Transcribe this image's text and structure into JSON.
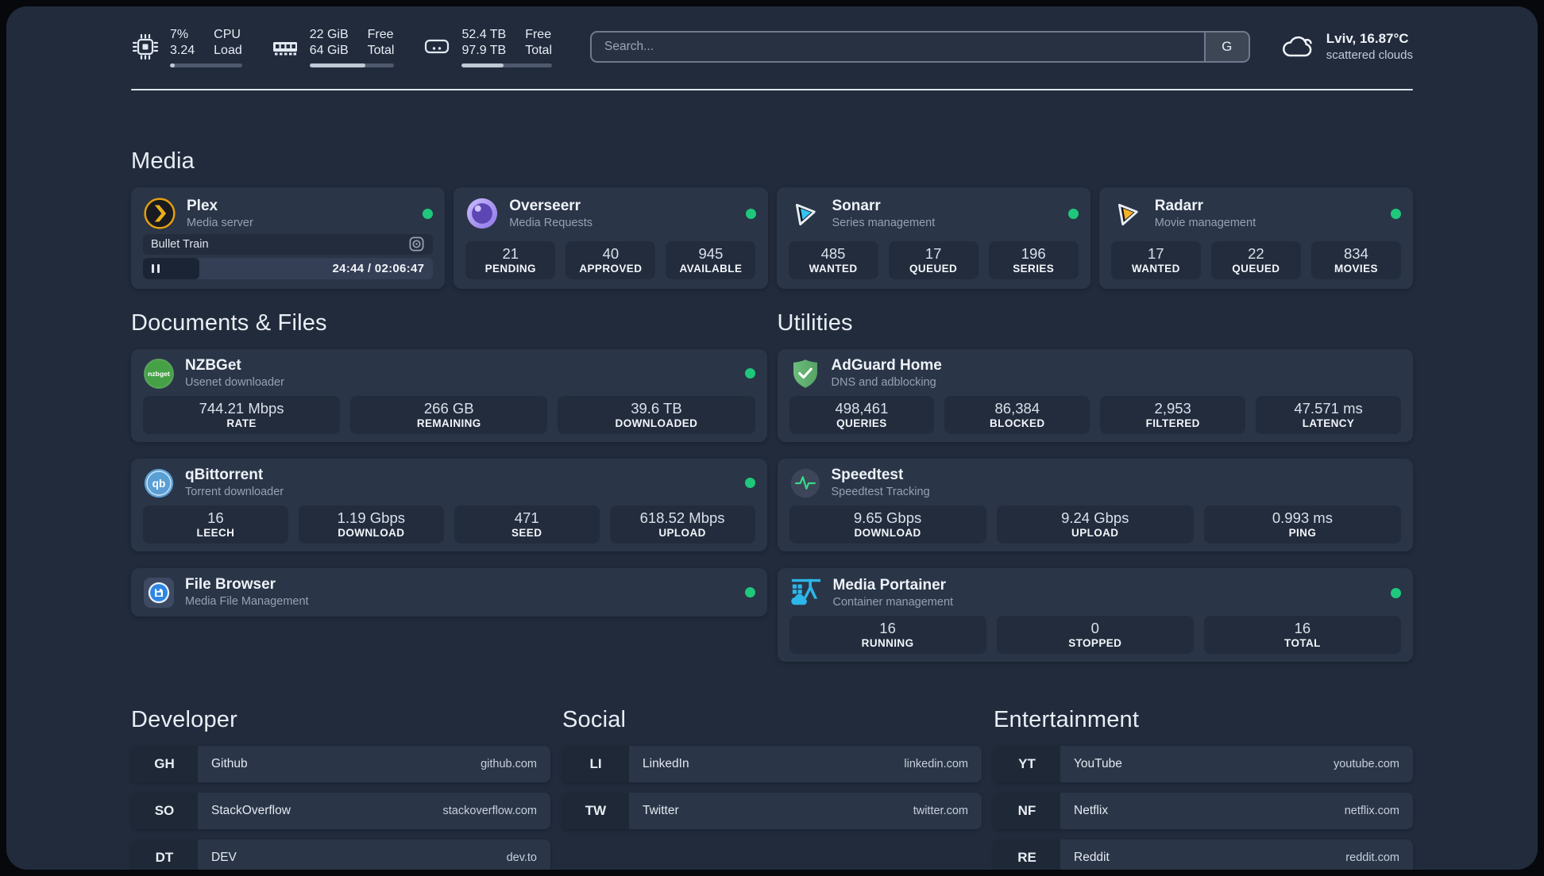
{
  "colors": {
    "page_bg": "#212b3c",
    "card_bg": "#2a3547",
    "inner_box_bg": "#222c3d",
    "status_online_green": "#1fc77c",
    "plex_amber": "#e5a00d",
    "sonarr_cyan": "#33c5f1",
    "radarr_amber": "#f6b126",
    "adguard_green": "#5fae6e",
    "speedtest_green": "#39d98a",
    "portainer_blue": "#2db6e8"
  },
  "topbar": {
    "cpu": {
      "icon": "cpu-icon",
      "line1_value": "7%",
      "line2_value": "3.24",
      "line1_label": "CPU",
      "line2_label": "Load",
      "progress_pct": 7
    },
    "memory": {
      "icon": "ram-icon",
      "line1_value": "22 GiB",
      "line2_value": "64 GiB",
      "line1_label": "Free",
      "line2_label": "Total",
      "progress_pct": 66
    },
    "disk": {
      "icon": "disk-icon",
      "line1_value": "52.4 TB",
      "line2_value": "97.9 TB",
      "line1_label": "Free",
      "line2_label": "Total",
      "progress_pct": 46
    },
    "search": {
      "placeholder": "Search...",
      "provider_label": "G"
    },
    "weather": {
      "icon": "cloud-icon",
      "location": "Lviv, 16.87°C",
      "condition": "scattered clouds"
    }
  },
  "sections": {
    "media": {
      "heading": "Media",
      "plex": {
        "icon": "plex-icon",
        "title": "Plex",
        "subtitle": "Media server",
        "online": true,
        "now_playing": "Bullet Train",
        "time_display": "24:44 / 02:06:47",
        "progress_pct": 19.5
      },
      "apps": [
        {
          "icon": "overseerr-icon",
          "title": "Overseerr",
          "subtitle": "Media Requests",
          "online": true,
          "stats": [
            {
              "value": "21",
              "label": "PENDING"
            },
            {
              "value": "40",
              "label": "APPROVED"
            },
            {
              "value": "945",
              "label": "AVAILABLE"
            }
          ]
        },
        {
          "icon": "sonarr-icon",
          "title": "Sonarr",
          "subtitle": "Series management",
          "online": true,
          "stats": [
            {
              "value": "485",
              "label": "WANTED"
            },
            {
              "value": "17",
              "label": "QUEUED"
            },
            {
              "value": "196",
              "label": "SERIES"
            }
          ]
        },
        {
          "icon": "radarr-icon",
          "title": "Radarr",
          "subtitle": "Movie management",
          "online": true,
          "stats": [
            {
              "value": "17",
              "label": "WANTED"
            },
            {
              "value": "22",
              "label": "QUEUED"
            },
            {
              "value": "834",
              "label": "MOVIES"
            }
          ]
        }
      ]
    },
    "documents": {
      "heading": "Documents & Files",
      "apps": [
        {
          "icon": "nzbget-icon",
          "title": "NZBGet",
          "subtitle": "Usenet downloader",
          "online": true,
          "stats": [
            {
              "value": "744.21 Mbps",
              "label": "RATE"
            },
            {
              "value": "266 GB",
              "label": "REMAINING"
            },
            {
              "value": "39.6 TB",
              "label": "DOWNLOADED"
            }
          ]
        },
        {
          "icon": "qbittorrent-icon",
          "title": "qBittorrent",
          "subtitle": "Torrent downloader",
          "online": true,
          "stats": [
            {
              "value": "16",
              "label": "LEECH"
            },
            {
              "value": "1.19 Gbps",
              "label": "DOWNLOAD"
            },
            {
              "value": "471",
              "label": "SEED"
            },
            {
              "value": "618.52 Mbps",
              "label": "UPLOAD"
            }
          ]
        },
        {
          "icon": "filebrowser-icon",
          "title": "File Browser",
          "subtitle": "Media File Management",
          "online": true,
          "stats": []
        }
      ]
    },
    "utilities": {
      "heading": "Utilities",
      "apps": [
        {
          "icon": "adguard-icon",
          "title": "AdGuard Home",
          "subtitle": "DNS and adblocking",
          "online": false,
          "stats": [
            {
              "value": "498,461",
              "label": "QUERIES"
            },
            {
              "value": "86,384",
              "label": "BLOCKED"
            },
            {
              "value": "2,953",
              "label": "FILTERED"
            },
            {
              "value": "47.571 ms",
              "label": "LATENCY"
            }
          ]
        },
        {
          "icon": "speedtest-icon",
          "title": "Speedtest",
          "subtitle": "Speedtest Tracking",
          "online": false,
          "stats": [
            {
              "value": "9.65 Gbps",
              "label": "DOWNLOAD"
            },
            {
              "value": "9.24 Gbps",
              "label": "UPLOAD"
            },
            {
              "value": "0.993 ms",
              "label": "PING"
            }
          ]
        },
        {
          "icon": "portainer-icon",
          "title": "Media Portainer",
          "subtitle": "Container management",
          "online": true,
          "stats": [
            {
              "value": "16",
              "label": "RUNNING"
            },
            {
              "value": "0",
              "label": "STOPPED"
            },
            {
              "value": "16",
              "label": "TOTAL"
            }
          ]
        }
      ]
    }
  },
  "links": {
    "developer": {
      "heading": "Developer",
      "items": [
        {
          "abbr": "GH",
          "name": "Github",
          "url": "github.com"
        },
        {
          "abbr": "SO",
          "name": "StackOverflow",
          "url": "stackoverflow.com"
        },
        {
          "abbr": "DT",
          "name": "DEV",
          "url": "dev.to"
        }
      ]
    },
    "social": {
      "heading": "Social",
      "items": [
        {
          "abbr": "LI",
          "name": "LinkedIn",
          "url": "linkedin.com"
        },
        {
          "abbr": "TW",
          "name": "Twitter",
          "url": "twitter.com"
        }
      ]
    },
    "entertainment": {
      "heading": "Entertainment",
      "items": [
        {
          "abbr": "YT",
          "name": "YouTube",
          "url": "youtube.com"
        },
        {
          "abbr": "NF",
          "name": "Netflix",
          "url": "netflix.com"
        },
        {
          "abbr": "RE",
          "name": "Reddit",
          "url": "reddit.com"
        }
      ]
    }
  }
}
